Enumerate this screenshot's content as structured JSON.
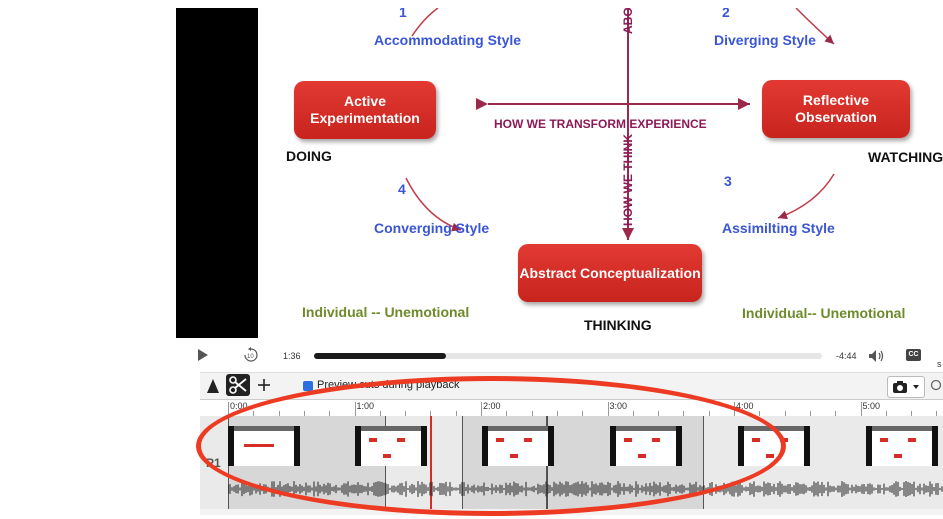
{
  "slide": {
    "style1_num": "1",
    "style1": "Accommodating Style",
    "style2_num": "2",
    "style2": "Diverging Style",
    "style3_num": "3",
    "style3": "Assimilting Style",
    "style4_num": "4",
    "style4": "Converging Style",
    "box_active": "Active Experimentation",
    "box_reflective": "Reflective Observation",
    "box_abstract": "Abstract Conceptualization",
    "transform": "HOW WE TRANSFORM EXPERIENCE",
    "think_top": "ABOUT THINK",
    "think_bottom": "HOW WE THINK",
    "doing": "DOING",
    "watching": "WATCHING",
    "thinking": "THINKING",
    "ind_left": "Individual -- Unemotional",
    "ind_right": "Individual-- Unemotional"
  },
  "player": {
    "current_time": "1:36",
    "remaining_time": "-4:44",
    "progress_fraction": 0.26,
    "cc_label": "CC",
    "s_label": "s"
  },
  "editor": {
    "preview_label": "Preview cuts during playback",
    "preview_checked": true,
    "track_label": "P1",
    "ruler": [
      "0:00",
      "1:00",
      "2:00",
      "3:00",
      "4:00",
      "5:00"
    ]
  },
  "colors": {
    "accent_red": "#ec3b22",
    "box_red": "#d62d27",
    "slide_blue": "#3a56d6"
  }
}
